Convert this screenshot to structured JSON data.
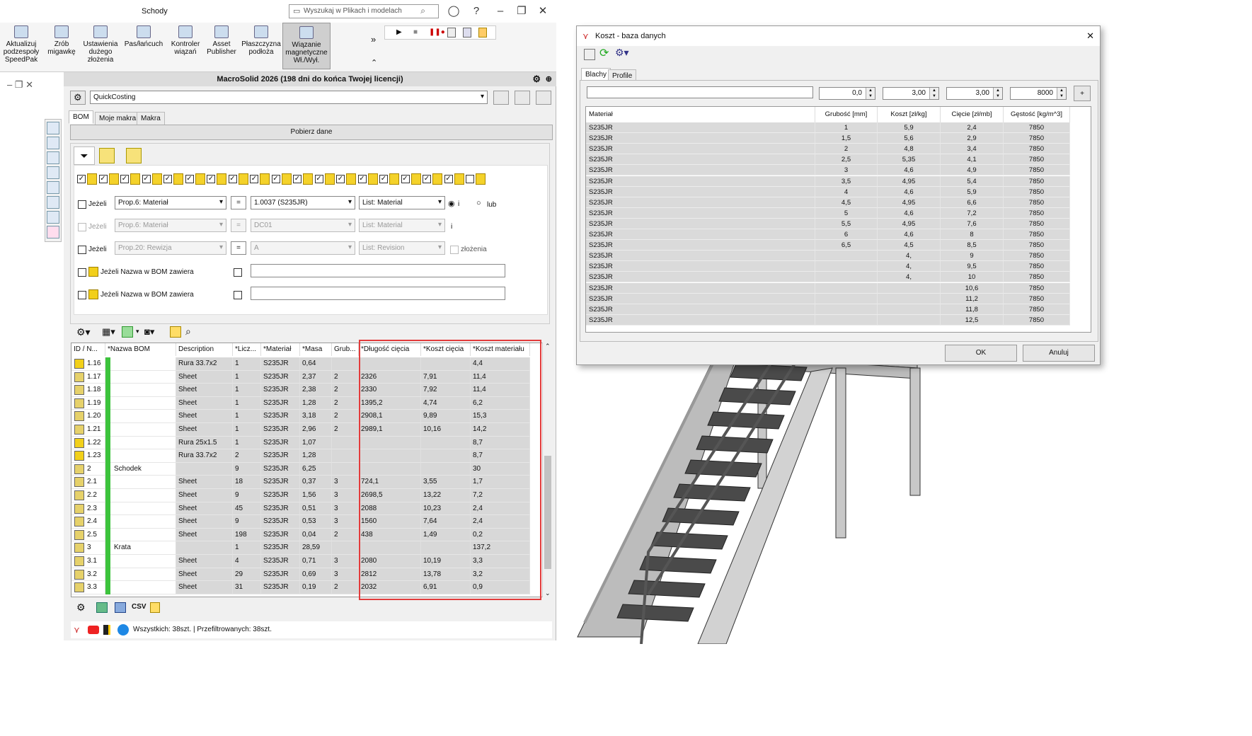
{
  "app": {
    "title": "Schody",
    "search_placeholder": "Wyszukaj w Plikach i modelach",
    "ribbon": [
      {
        "label": "Aktualizuj\npodzespoły\nSpeedPak"
      },
      {
        "label": "Zrób\nmigawkę"
      },
      {
        "label": "Ustawienia\ndużego\nzłożenia"
      },
      {
        "label": "Pas/łańcuch"
      },
      {
        "label": "Kontroler\nwiązań"
      },
      {
        "label": "Asset\nPublisher"
      },
      {
        "label": "Płaszczyzna\npodłoża"
      },
      {
        "label": "Wiązanie\nmagnetyczne\nWł./Wył."
      }
    ],
    "ribbon_more": "»"
  },
  "macrosolid": {
    "header": "MacroSolid 2026 (198 dni do końca Twojej licencji)",
    "profile": "QuickCosting",
    "tabs": [
      "BOM",
      "Moje makra",
      "Makra"
    ],
    "fetch_button": "Pobierz dane",
    "filters": [
      {
        "label": "Jeżeli",
        "prop": "Prop.6: Materiał",
        "op": "=",
        "value": "1.0037 (S235JR)",
        "list": "List: Material",
        "join_i": "i",
        "join_lub": "lub",
        "enabled": true
      },
      {
        "label": "Jeżeli",
        "prop": "Prop.6: Materiał",
        "op": "=",
        "value": "DC01",
        "list": "List: Material",
        "join_i": "i",
        "enabled": false
      },
      {
        "label": "Jeżeli",
        "prop": "Prop.20: Rewizja",
        "op": "=",
        "value": "A",
        "list": "List: Revision",
        "extra": "złożenia",
        "enabled": true
      }
    ],
    "name_filters": [
      {
        "label": "Jeżeli Nazwa w BOM zawiera",
        "value": ""
      },
      {
        "label": "Jeżeli Nazwa w BOM zawiera",
        "value": ""
      }
    ],
    "grid": {
      "columns": [
        "ID / N...",
        "*Nazwa BOM",
        "Description",
        "*Licz...",
        "*Materiał",
        "*Masa",
        "Grub...",
        "*Długość cięcia",
        "*Koszt cięcia",
        "*Koszt materiału"
      ],
      "rows": [
        [
          "1.16",
          "",
          "Rura 33.7x2",
          "1",
          "S235JR",
          "0,64",
          "",
          "",
          "",
          "4,4"
        ],
        [
          "1.17",
          "",
          "Sheet",
          "1",
          "S235JR",
          "2,37",
          "2",
          "2326",
          "7,91",
          "11,4"
        ],
        [
          "1.18",
          "",
          "Sheet",
          "1",
          "S235JR",
          "2,38",
          "2",
          "2330",
          "7,92",
          "11,4"
        ],
        [
          "1.19",
          "",
          "Sheet",
          "1",
          "S235JR",
          "1,28",
          "2",
          "1395,2",
          "4,74",
          "6,2"
        ],
        [
          "1.20",
          "",
          "Sheet",
          "1",
          "S235JR",
          "3,18",
          "2",
          "2908,1",
          "9,89",
          "15,3"
        ],
        [
          "1.21",
          "",
          "Sheet",
          "1",
          "S235JR",
          "2,96",
          "2",
          "2989,1",
          "10,16",
          "14,2"
        ],
        [
          "1.22",
          "",
          "Rura 25x1.5",
          "1",
          "S235JR",
          "1,07",
          "",
          "",
          "",
          "8,7"
        ],
        [
          "1.23",
          "",
          "Rura 33.7x2",
          "2",
          "S235JR",
          "1,28",
          "",
          "",
          "",
          "8,7"
        ],
        [
          "2",
          "Schodek",
          "",
          "9",
          "S235JR",
          "6,25",
          "",
          "",
          "",
          "30"
        ],
        [
          "2.1",
          "",
          "Sheet",
          "18",
          "S235JR",
          "0,37",
          "3",
          "724,1",
          "3,55",
          "1,7"
        ],
        [
          "2.2",
          "",
          "Sheet",
          "9",
          "S235JR",
          "1,56",
          "3",
          "2698,5",
          "13,22",
          "7,2"
        ],
        [
          "2.3",
          "",
          "Sheet",
          "45",
          "S235JR",
          "0,51",
          "3",
          "2088",
          "10,23",
          "2,4"
        ],
        [
          "2.4",
          "",
          "Sheet",
          "9",
          "S235JR",
          "0,53",
          "3",
          "1560",
          "7,64",
          "2,4"
        ],
        [
          "2.5",
          "",
          "Sheet",
          "198",
          "S235JR",
          "0,04",
          "2",
          "438",
          "1,49",
          "0,2"
        ],
        [
          "3",
          "Krata",
          "",
          "1",
          "S235JR",
          "28,59",
          "",
          "",
          "",
          "137,2"
        ],
        [
          "3.1",
          "",
          "Sheet",
          "4",
          "S235JR",
          "0,71",
          "3",
          "2080",
          "10,19",
          "3,3"
        ],
        [
          "3.2",
          "",
          "Sheet",
          "29",
          "S235JR",
          "0,69",
          "3",
          "2812",
          "13,78",
          "3,2"
        ],
        [
          "3.3",
          "",
          "Sheet",
          "31",
          "S235JR",
          "0,19",
          "2",
          "2032",
          "6,91",
          "0,9"
        ]
      ]
    },
    "csv_label": "CSV",
    "status": "Wszystkich: 38szt. | Przefiltrowanych: 38szt."
  },
  "dialog": {
    "title": "Koszt - baza danych",
    "tabs": [
      "Blachy",
      "Profile"
    ],
    "inputs": {
      "name": "",
      "thickness": "0,0",
      "cost_kg": "3,00",
      "cut_cost": "3,00",
      "density": "8000"
    },
    "add_label": "+",
    "columns": [
      "Materiał",
      "Grubość [mm]",
      "Koszt [zł/kg]",
      "Cięcie [zł/mb]",
      "Gęstość [kg/m^3]"
    ],
    "rows": [
      [
        "S235JR",
        "1",
        "5,9",
        "2,4",
        "7850"
      ],
      [
        "S235JR",
        "1,5",
        "5,6",
        "2,9",
        "7850"
      ],
      [
        "S235JR",
        "2",
        "4,8",
        "3,4",
        "7850"
      ],
      [
        "S235JR",
        "2,5",
        "5,35",
        "4,1",
        "7850"
      ],
      [
        "S235JR",
        "3",
        "4,6",
        "4,9",
        "7850"
      ],
      [
        "S235JR",
        "3,5",
        "4,95",
        "5,4",
        "7850"
      ],
      [
        "S235JR",
        "4",
        "4,6",
        "5,9",
        "7850"
      ],
      [
        "S235JR",
        "4,5",
        "4,95",
        "6,6",
        "7850"
      ],
      [
        "S235JR",
        "5",
        "4,6",
        "7,2",
        "7850"
      ],
      [
        "S235JR",
        "5,5",
        "4,95",
        "7,6",
        "7850"
      ],
      [
        "S235JR",
        "6",
        "4,6",
        "8",
        "7850"
      ],
      [
        "S235JR",
        "6,5",
        "4,5",
        "8,5",
        "7850"
      ],
      [
        "S235JR",
        "",
        "4,",
        "9",
        "7850"
      ],
      [
        "S235JR",
        "",
        "4,",
        "9,5",
        "7850"
      ],
      [
        "S235JR",
        "",
        "4,",
        "10",
        "7850"
      ],
      [
        "S235JR",
        "",
        "",
        "10,6",
        "7850"
      ],
      [
        "S235JR",
        "",
        "",
        "11,2",
        "7850"
      ],
      [
        "S235JR",
        "",
        "",
        "11,8",
        "7850"
      ],
      [
        "S235JR",
        "",
        "",
        "12,5",
        "7850"
      ]
    ],
    "ok": "OK",
    "cancel": "Anuluj"
  },
  "colors": {
    "highlight": "#e23b3b",
    "green_bar": "#3cc33c",
    "row_gray": "#d8d8d8"
  }
}
